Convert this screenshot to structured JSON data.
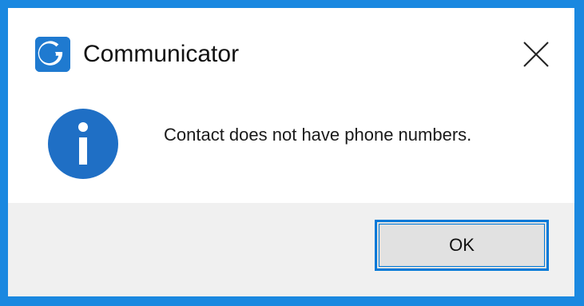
{
  "window": {
    "title": "Communicator",
    "app_icon": "communicator-logo-icon",
    "close_icon": "close-icon"
  },
  "dialog": {
    "icon": "information-icon",
    "message": "Contact does not have phone numbers."
  },
  "buttons": {
    "ok_label": "OK"
  },
  "colors": {
    "accent": "#0078d7",
    "info_blue": "#1f6fc5",
    "footer_bg": "#f0f0f0",
    "desktop": "#1a88e0"
  }
}
